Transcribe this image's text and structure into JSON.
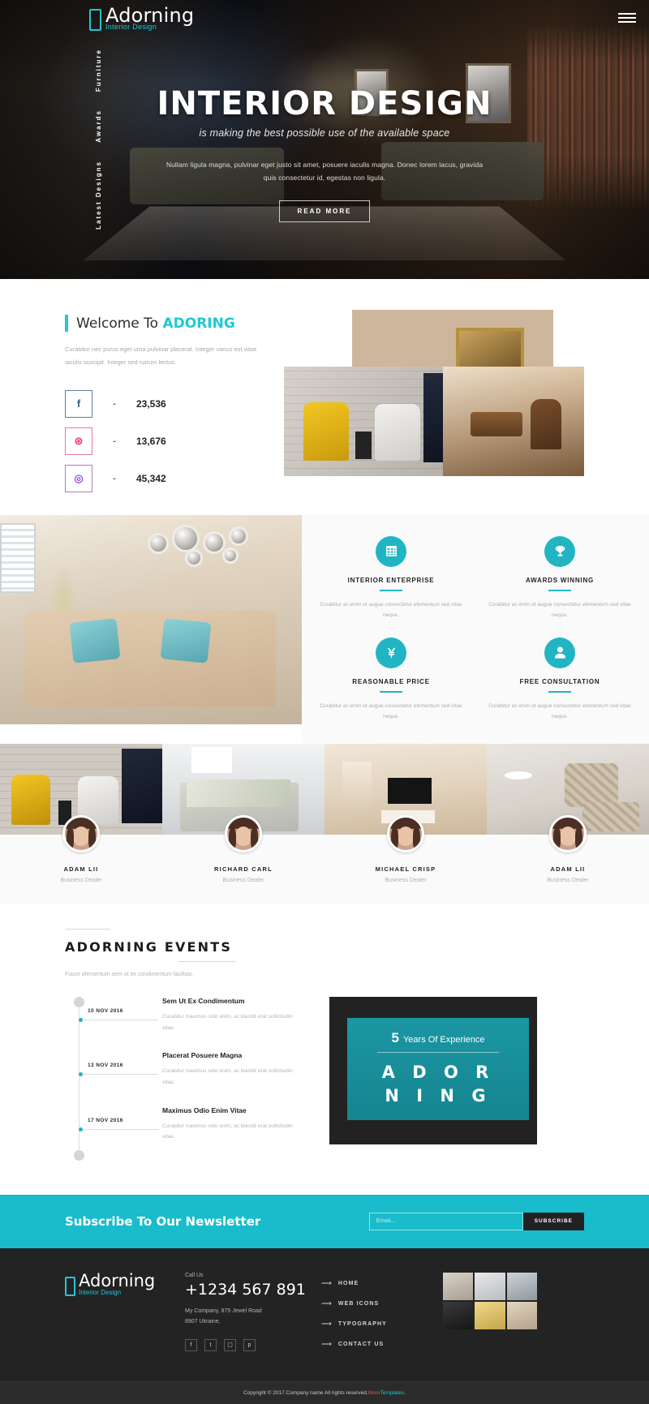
{
  "brand": {
    "name": "Adorning",
    "tagline": "Interior Design"
  },
  "hero": {
    "nav": [
      "Furniture",
      "Awards",
      "Latest Designs"
    ],
    "title": "INTERIOR DESIGN",
    "subtitle": "is making the best possible use of the available space",
    "paragraph": "Nullam ligula magna, pulvinar eget justo sit amet, posuere iaculis magna. Donec lorem lacus, gravida quis consectetur id, egestas non ligula.",
    "cta": "READ MORE"
  },
  "welcome": {
    "title_prefix": "Welcome To ",
    "title_accent": "ADORING",
    "paragraph": "Curabitur nec purus eget urna pulvinar placerat. Integer varius est vitae iaculis suscipit. Integer sed rutrum lectus.",
    "counters": [
      {
        "icon": "facebook-icon",
        "glyph": "f",
        "dash": "-",
        "value": "23,536"
      },
      {
        "icon": "dribbble-icon",
        "glyph": "⊛",
        "dash": "-",
        "value": "13,676"
      },
      {
        "icon": "instagram-icon",
        "glyph": "◎",
        "dash": "-",
        "value": "45,342"
      }
    ]
  },
  "features": [
    {
      "icon": "building-grid-icon",
      "title": "INTERIOR ENTERPRISE",
      "desc": "Curabitur ac enim et augue consectetur elementum sed vitae neque."
    },
    {
      "icon": "trophy-icon",
      "title": "AWARDS WINNING",
      "desc": "Curabitur ac enim et augue consectetur elementum sed vitae neque."
    },
    {
      "icon": "yen-price-icon",
      "title": "REASONABLE PRICE",
      "desc": "Curabitur ac enim et augue consectetur elementum sed vitae neque."
    },
    {
      "icon": "user-icon",
      "title": "FREE CONSULTATION",
      "desc": "Curabitur ac enim et augue consectetur elementum sed vitae neque."
    }
  ],
  "team": [
    {
      "name": "ADAM LII",
      "role": "Business Dealer"
    },
    {
      "name": "RICHARD CARL",
      "role": "Business Dealer"
    },
    {
      "name": "MICHAEL CRISP",
      "role": "Business Dealer"
    },
    {
      "name": "ADAM LII",
      "role": "Business Dealer"
    }
  ],
  "events": {
    "title": "ADORNING EVENTS",
    "subtitle": "Fusce elementum sem ut ex condimentum facilisis.",
    "items": [
      {
        "date": "10 NOV 2016",
        "heading": "Sem Ut Ex Condimentum",
        "desc": "Curabitur maximus odio enim, ac blandit erat sollicitudin vitae."
      },
      {
        "date": "13 NOV 2016",
        "heading": "Placerat Posuere Magna",
        "desc": "Curabitur maximus odio enim, ac blandit erat sollicitudin vitae."
      },
      {
        "date": "17 NOV 2016",
        "heading": "Maximus Odio Enim Vitae",
        "desc": "Curabitur maximus odio enim, ac blandit erat sollicitudin vitae."
      }
    ],
    "experience": {
      "number": "5",
      "label": "Years Of Experience",
      "word_line1": "A D O R",
      "word_line2": "N I N G"
    }
  },
  "newsletter": {
    "title": "Subscribe To Our Newsletter",
    "placeholder": "Email...",
    "button": "SUBSCRIBE"
  },
  "footer": {
    "call_us": "Call Us",
    "phone": "+1234 567 891",
    "address_line1": "My Company, 875 Jewel Road",
    "address_line2": "8907 Ukraine,",
    "social": [
      {
        "name": "facebook-icon",
        "glyph": "f"
      },
      {
        "name": "twitter-icon",
        "glyph": "t"
      },
      {
        "name": "instagram-icon",
        "glyph": "▢"
      },
      {
        "name": "pinterest-icon",
        "glyph": "p"
      }
    ],
    "links": [
      "HOME",
      "WEB ICONS",
      "TYPOGRAPHY",
      "CONTACT US"
    ],
    "copyright_pre": "Copyright © 2017.Company name All rights reserved.",
    "copyright_link1": "More",
    "copyright_link2": "Templates",
    "copyright_link3": ".",
    "accent": "#21c7d4"
  }
}
